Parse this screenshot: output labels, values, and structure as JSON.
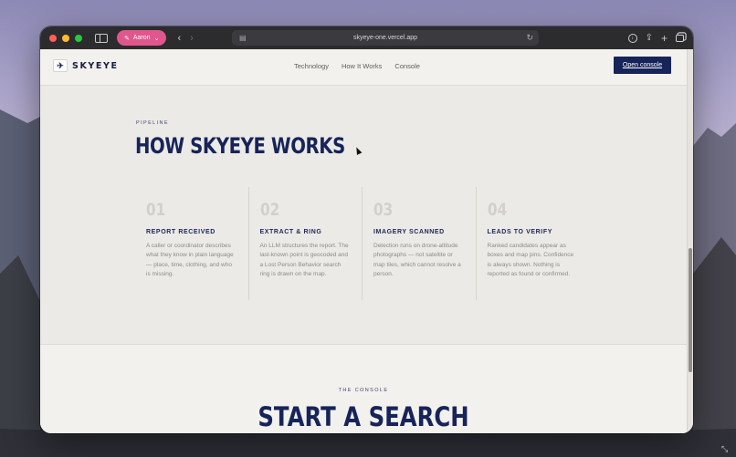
{
  "browser": {
    "profile_label": "Aaron",
    "url": "skyeye-one.vercel.app",
    "icons": [
      "sidebar-toggle-icon",
      "back-arrow-icon",
      "forward-arrow-icon",
      "page-icon",
      "reload-icon",
      "download-icon",
      "share-icon",
      "new-tab-icon",
      "tabs-overview-icon"
    ]
  },
  "site": {
    "brand": "SKYEYE",
    "nav": [
      "Technology",
      "How It Works",
      "Console"
    ],
    "cta_label": "Open console",
    "colors": {
      "navy": "#16245a",
      "background": "#eceae6",
      "muted_text": "#8d8b86"
    }
  },
  "pipeline": {
    "eyebrow": "PIPELINE",
    "headline": "HOW SKYEYE WORKS",
    "steps": [
      {
        "num": "01",
        "title": "REPORT RECEIVED",
        "body": "A caller or coordinator describes what they know in plain language — place, time, clothing, and who is missing."
      },
      {
        "num": "02",
        "title": "EXTRACT & RING",
        "body": "An LLM structures the report. The last-known point is geocoded and a Lost Person Behavior search ring is drawn on the map."
      },
      {
        "num": "03",
        "title": "IMAGERY SCANNED",
        "body": "Detection runs on drone-altitude photographs — not satellite or map tiles, which cannot resolve a person."
      },
      {
        "num": "04",
        "title": "LEADS TO VERIFY",
        "body": "Ranked candidates appear as boxes and map pins. Confidence is always shown. Nothing is reported as found or confirmed."
      }
    ]
  },
  "console_section": {
    "eyebrow": "THE CONSOLE",
    "title": "START A SEARCH"
  }
}
